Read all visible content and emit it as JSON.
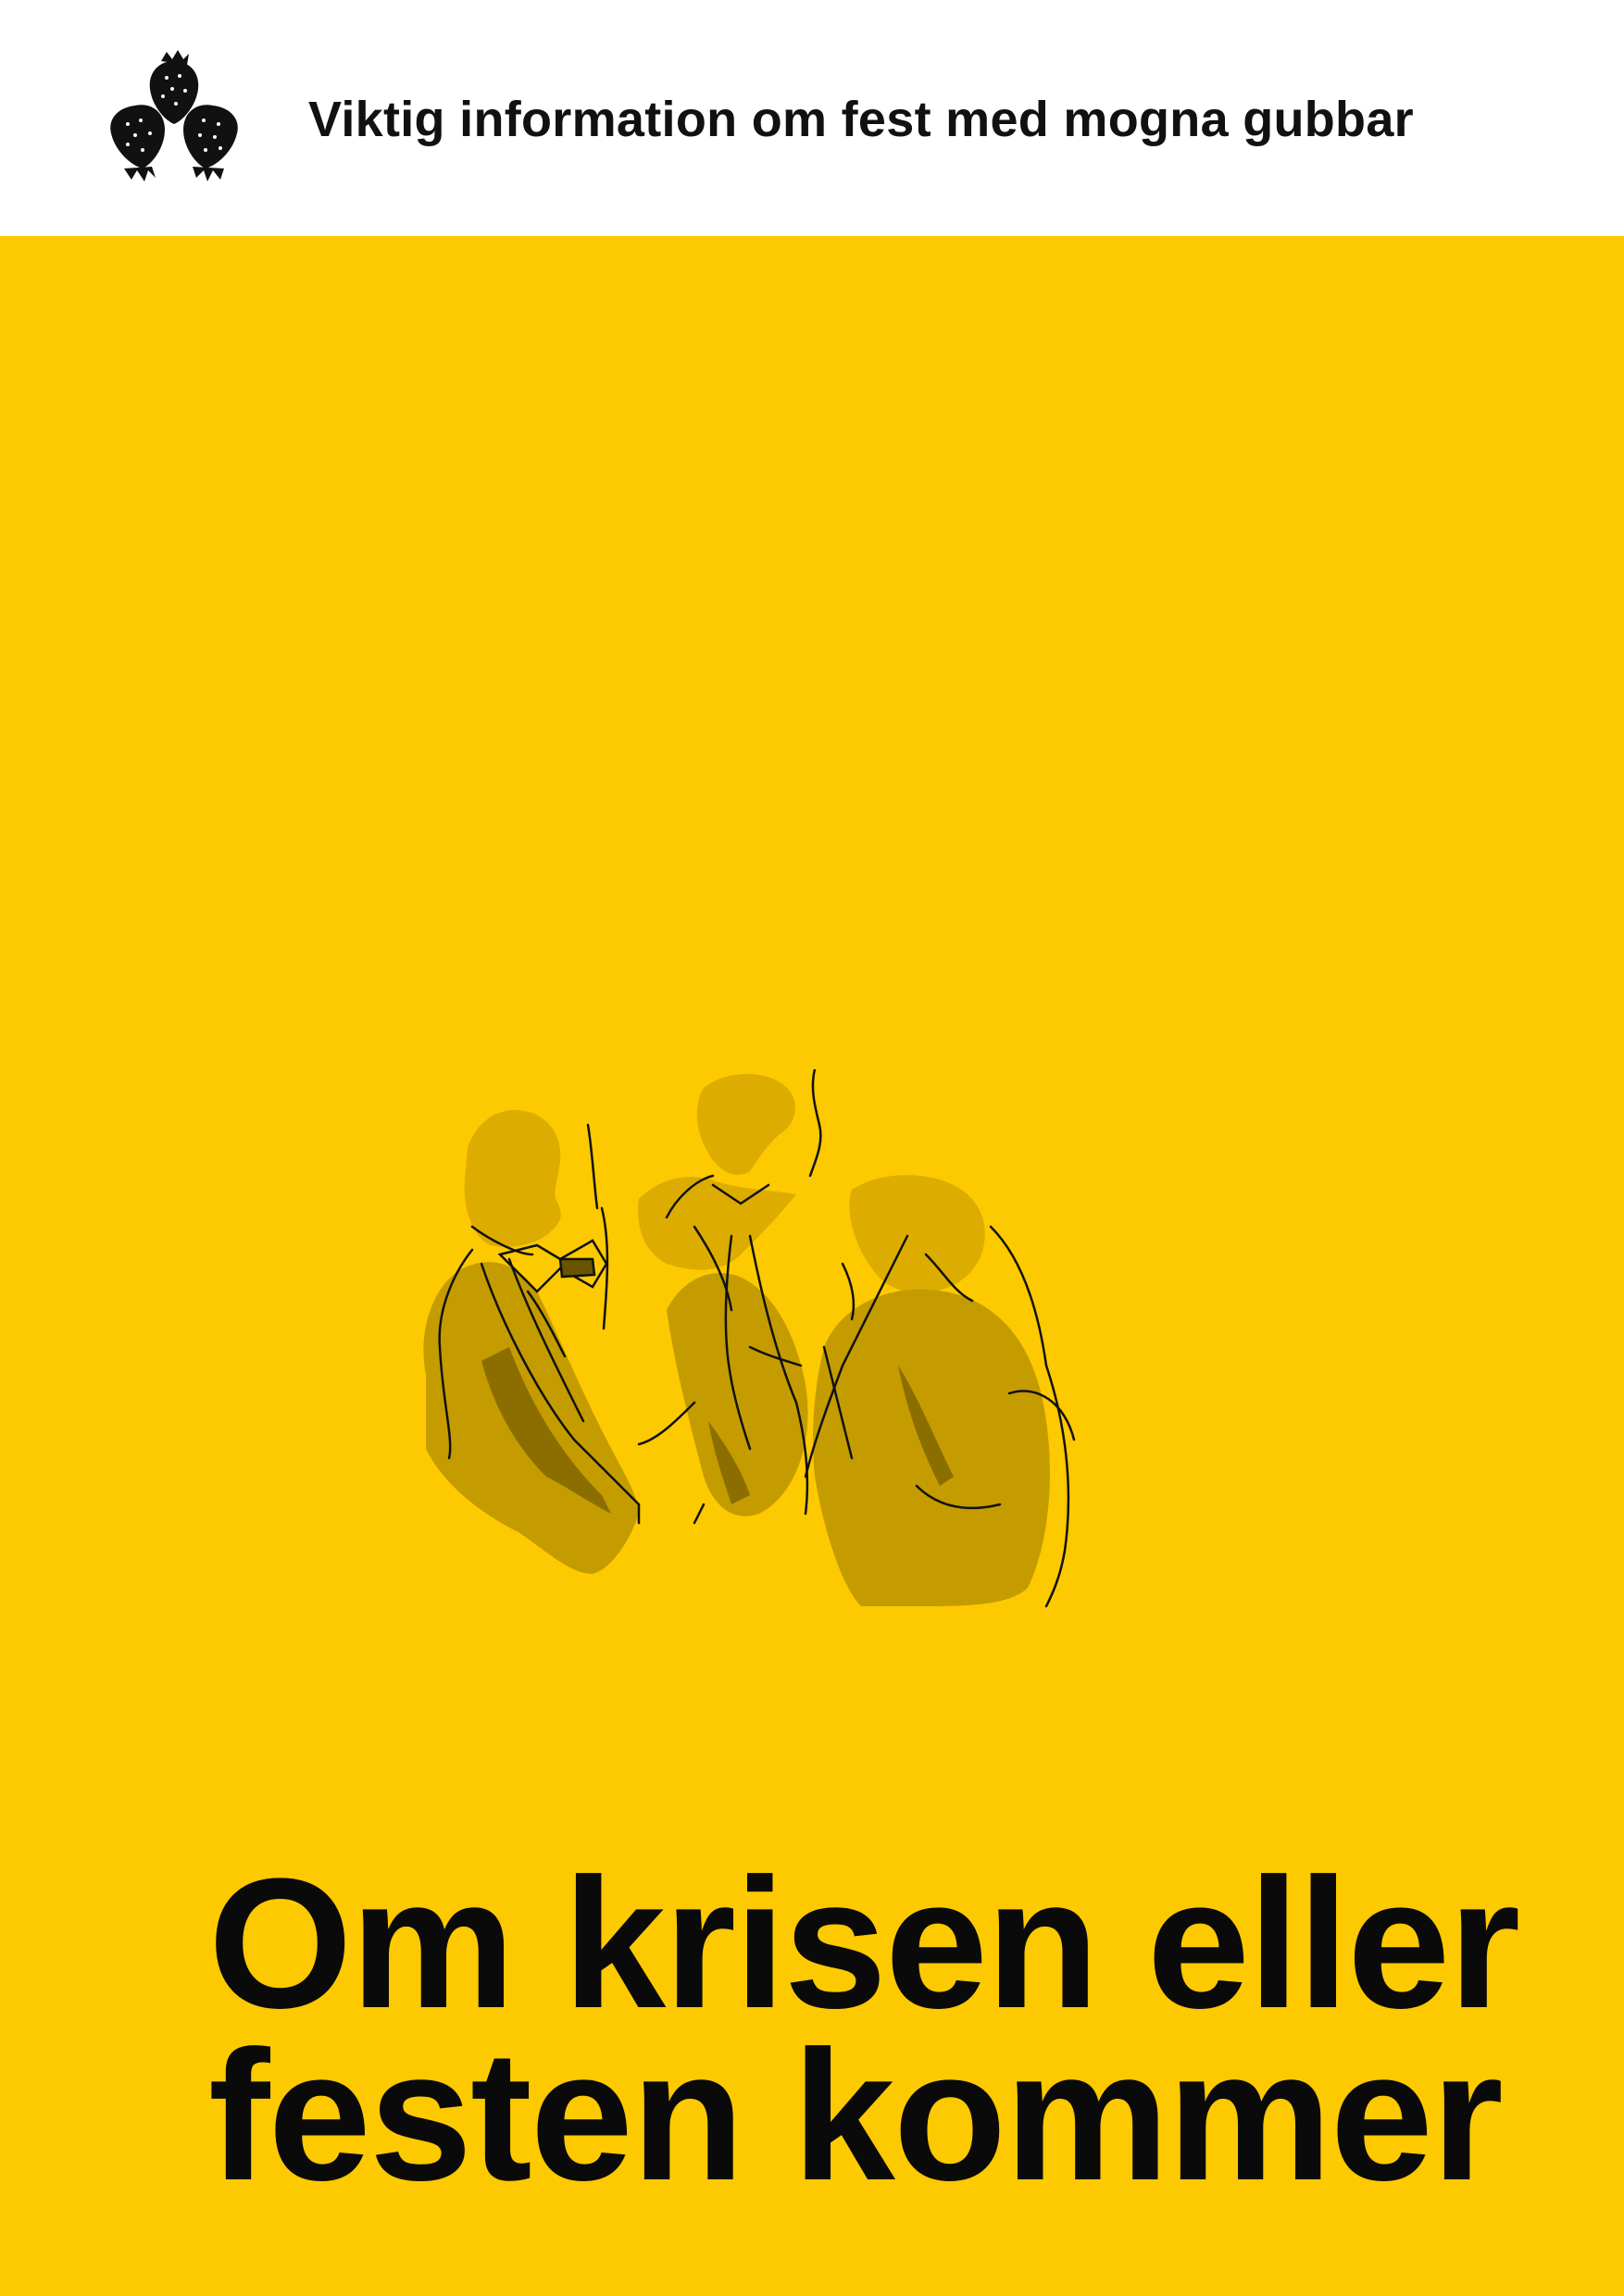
{
  "header": {
    "subtitle": "Viktig information om fest med mogna gubbar",
    "logo_icon": "strawberries-logo-icon"
  },
  "main": {
    "illustration_icon": "three-men-in-suits-illustration",
    "headline_line1": "Om krisen eller",
    "headline_line2": "festen kommer"
  },
  "colors": {
    "background": "#fdc900",
    "header_background": "#ffffff",
    "text": "#0a0a0a",
    "illustration_fill": "#c49c00",
    "illustration_shadow": "#8c6e00"
  }
}
